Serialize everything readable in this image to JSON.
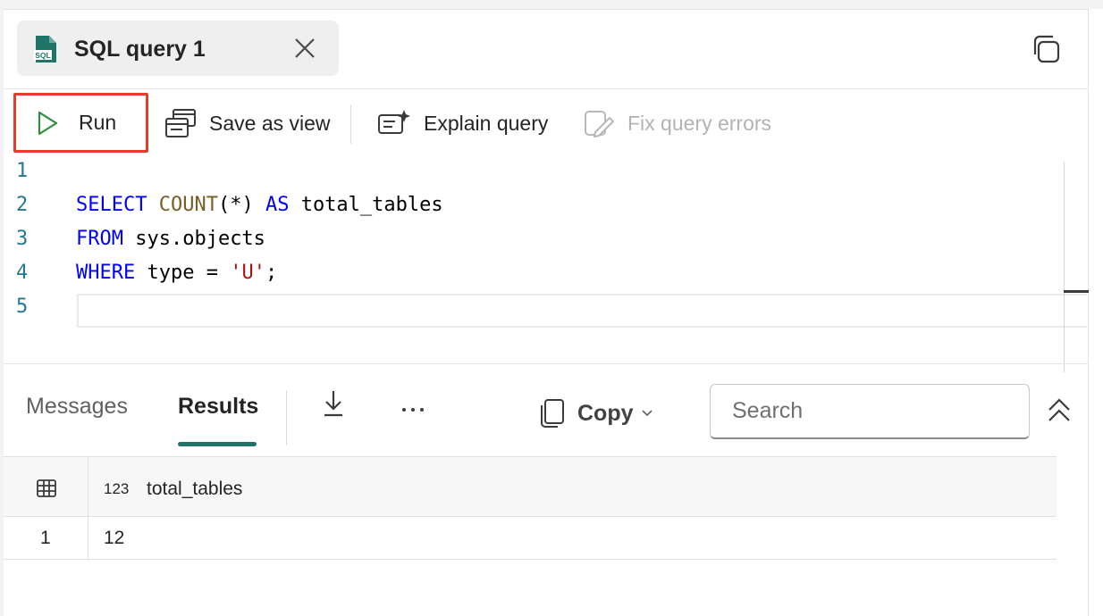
{
  "tab": {
    "title": "SQL query 1",
    "file_icon": "sql-file-icon",
    "close_icon": "close-icon"
  },
  "window": {
    "copy_icon": "copy-window-icon"
  },
  "toolbar": {
    "run_label": "Run",
    "save_label": "Save as view",
    "explain_label": "Explain query",
    "fix_label": "Fix query errors",
    "highlight_color": "#e0402a"
  },
  "editor": {
    "line_numbers": [
      "1",
      "2",
      "3",
      "4",
      "5"
    ],
    "lines": [
      [],
      [
        {
          "t": "SELECT",
          "c": "kw"
        },
        {
          "t": " "
        },
        {
          "t": "COUNT",
          "c": "fn"
        },
        {
          "t": "(*) "
        },
        {
          "t": "AS",
          "c": "kw"
        },
        {
          "t": " total_tables"
        }
      ],
      [
        {
          "t": "FROM",
          "c": "kw"
        },
        {
          "t": " sys.objects"
        }
      ],
      [
        {
          "t": "WHERE",
          "c": "kw"
        },
        {
          "t": " type = "
        },
        {
          "t": "'U'",
          "c": "str"
        },
        {
          "t": ";"
        }
      ],
      []
    ]
  },
  "results": {
    "tabs": {
      "messages": "Messages",
      "results": "Results"
    },
    "active_tab": "Results",
    "copy_label": "Copy",
    "search_placeholder": "Search",
    "accent_color": "#1f7467",
    "columns": [
      {
        "name": "total_tables",
        "type_badge": "123"
      }
    ],
    "rows": [
      {
        "index": "1",
        "values": [
          "12"
        ]
      }
    ]
  }
}
